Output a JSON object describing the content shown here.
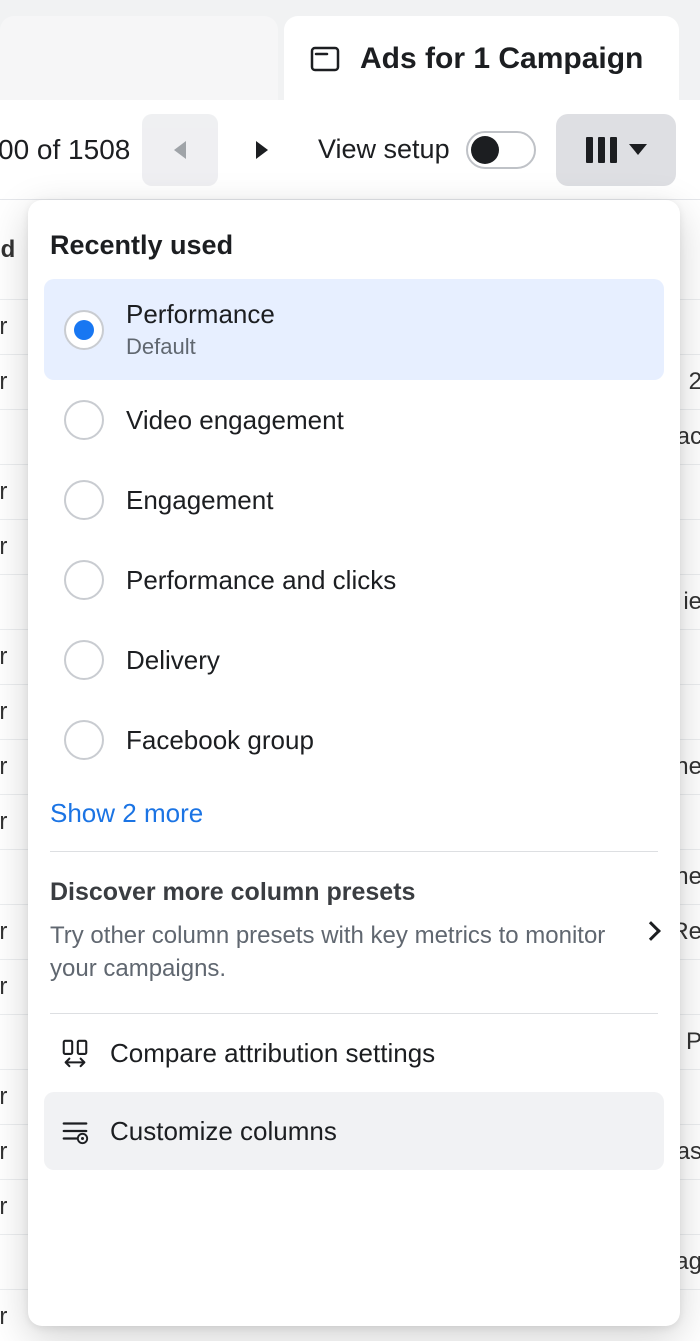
{
  "tab": {
    "title": "Ads for 1 Campaign"
  },
  "toolbar": {
    "count_text": "00 of 1508",
    "view_setup_label": "View setup"
  },
  "panel": {
    "recently_used_title": "Recently used",
    "options": [
      {
        "label": "Performance",
        "sub": "Default",
        "selected": true
      },
      {
        "label": "Video engagement",
        "sub": "",
        "selected": false
      },
      {
        "label": "Engagement",
        "sub": "",
        "selected": false
      },
      {
        "label": "Performance and clicks",
        "sub": "",
        "selected": false
      },
      {
        "label": "Delivery",
        "sub": "",
        "selected": false
      },
      {
        "label": "Facebook group",
        "sub": "",
        "selected": false
      }
    ],
    "show_more_label": "Show 2 more",
    "discover": {
      "title": "Discover more column presets",
      "desc": "Try other column presets with key metrics to monitor your campaigns."
    },
    "compare_label": "Compare attribution settings",
    "customize_label": "Customize columns"
  },
  "bg": {
    "header_left": "ıd",
    "rows": [
      {
        "left": "ir",
        "right": ""
      },
      {
        "left": "ir",
        "right": "2"
      },
      {
        "left": "",
        "right": "ac"
      },
      {
        "left": "ir",
        "right": ""
      },
      {
        "left": "ir",
        "right": ""
      },
      {
        "left": "",
        "right": "ie"
      },
      {
        "left": "ir",
        "right": ""
      },
      {
        "left": "ir",
        "right": ""
      },
      {
        "left": "ir",
        "right": "ne"
      },
      {
        "left": "ir",
        "right": ""
      },
      {
        "left": "",
        "right": "ne"
      },
      {
        "left": "ir",
        "right": "Re"
      },
      {
        "left": "ir",
        "right": ""
      },
      {
        "left": "",
        "right": "P"
      },
      {
        "left": "ir",
        "right": ""
      },
      {
        "left": "ir",
        "right": "as"
      },
      {
        "left": "ir",
        "right": ""
      },
      {
        "left": "",
        "right": "ag"
      },
      {
        "left": "ir",
        "right": ""
      }
    ]
  }
}
